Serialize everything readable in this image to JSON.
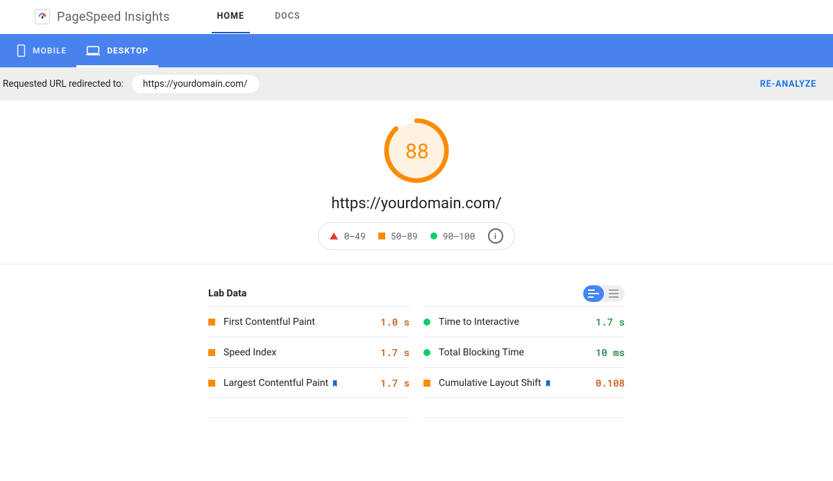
{
  "app": {
    "title": "PageSpeed Insights",
    "logo_icon": "gauge-logo-icon"
  },
  "nav": {
    "tabs": [
      {
        "label": "HOME",
        "active": true
      },
      {
        "label": "DOCS",
        "active": false
      }
    ]
  },
  "device_tabs": [
    {
      "icon": "mobile-icon",
      "label": "MOBILE",
      "active": false
    },
    {
      "icon": "desktop-icon",
      "label": "DESKTOP",
      "active": true
    }
  ],
  "info_bar": {
    "label": "Requested URL redirected to:",
    "url": "https://yourdomain.com/",
    "reanalyze_label": "RE-ANALYZE"
  },
  "hero": {
    "score": "88",
    "score_fraction": 0.88,
    "url": "https://yourdomain.com/",
    "legend": [
      {
        "shape": "triangle",
        "label": "0–49"
      },
      {
        "shape": "square",
        "label": "50–89"
      },
      {
        "shape": "circle",
        "label": "90–100"
      }
    ]
  },
  "lab": {
    "title": "Lab Data",
    "columns": [
      [
        {
          "indicator": "square",
          "name": "First Contentful Paint",
          "badge": false,
          "value": "1.0 s",
          "color": "orange"
        },
        {
          "indicator": "square",
          "name": "Speed Index",
          "badge": false,
          "value": "1.7 s",
          "color": "orange"
        },
        {
          "indicator": "square",
          "name": "Largest Contentful Paint",
          "badge": true,
          "value": "1.7 s",
          "color": "orange"
        }
      ],
      [
        {
          "indicator": "circle",
          "name": "Time to Interactive",
          "badge": false,
          "value": "1.7 s",
          "color": "green"
        },
        {
          "indicator": "circle",
          "name": "Total Blocking Time",
          "badge": false,
          "value": "10 ms",
          "color": "green"
        },
        {
          "indicator": "square",
          "name": "Cumulative Layout Shift",
          "badge": true,
          "value": "0.108",
          "color": "orange"
        }
      ]
    ]
  },
  "chart_data": {
    "type": "gauge",
    "title": "Performance score",
    "value": 88,
    "range": [
      0,
      100
    ],
    "bands": [
      {
        "label": "0–49",
        "color": "#e53935"
      },
      {
        "label": "50–89",
        "color": "#fb8c00"
      },
      {
        "label": "90–100",
        "color": "#0cce6b"
      }
    ]
  }
}
